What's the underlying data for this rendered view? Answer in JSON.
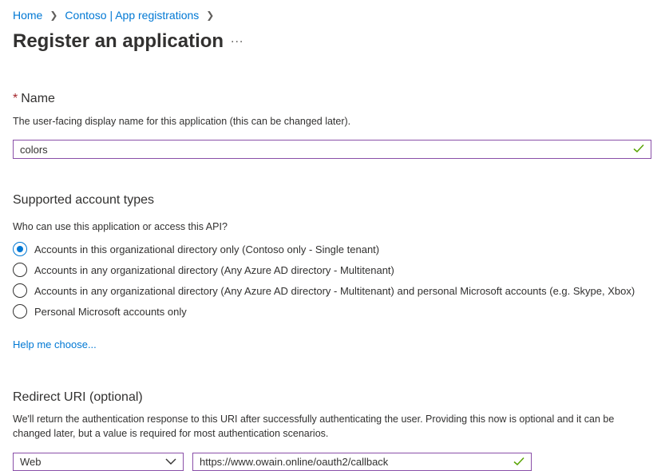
{
  "breadcrumb": {
    "items": [
      "Home",
      "Contoso | App registrations"
    ],
    "separator": ">"
  },
  "page": {
    "title": "Register an application",
    "more_label": "..."
  },
  "name_section": {
    "required_mark": "*",
    "label": "Name",
    "description": "The user-facing display name for this application (this can be changed later).",
    "value": "colors",
    "valid_icon": "checkmark-icon"
  },
  "account_types": {
    "label": "Supported account types",
    "question": "Who can use this application or access this API?",
    "options": [
      {
        "label": "Accounts in this organizational directory only (Contoso only - Single tenant)",
        "selected": true
      },
      {
        "label": "Accounts in any organizational directory (Any Azure AD directory - Multitenant)",
        "selected": false
      },
      {
        "label": "Accounts in any organizational directory (Any Azure AD directory - Multitenant) and personal Microsoft accounts (e.g. Skype, Xbox)",
        "selected": false
      },
      {
        "label": "Personal Microsoft accounts only",
        "selected": false
      }
    ],
    "help_link": "Help me choose..."
  },
  "redirect": {
    "label": "Redirect URI (optional)",
    "description_line1": "We'll return the authentication response to this URI after successfully authenticating the user. Providing this now is optional and it can be",
    "description_line2": "changed later, but a value is required for most authentication scenarios.",
    "platform": "Web",
    "uri": "https://www.owain.online/oauth2/callback",
    "valid_icon": "checkmark-icon"
  },
  "colors": {
    "link": "#0078d4",
    "input_border": "#8a4fa8",
    "valid": "#57a300",
    "required": "#a4262c"
  }
}
